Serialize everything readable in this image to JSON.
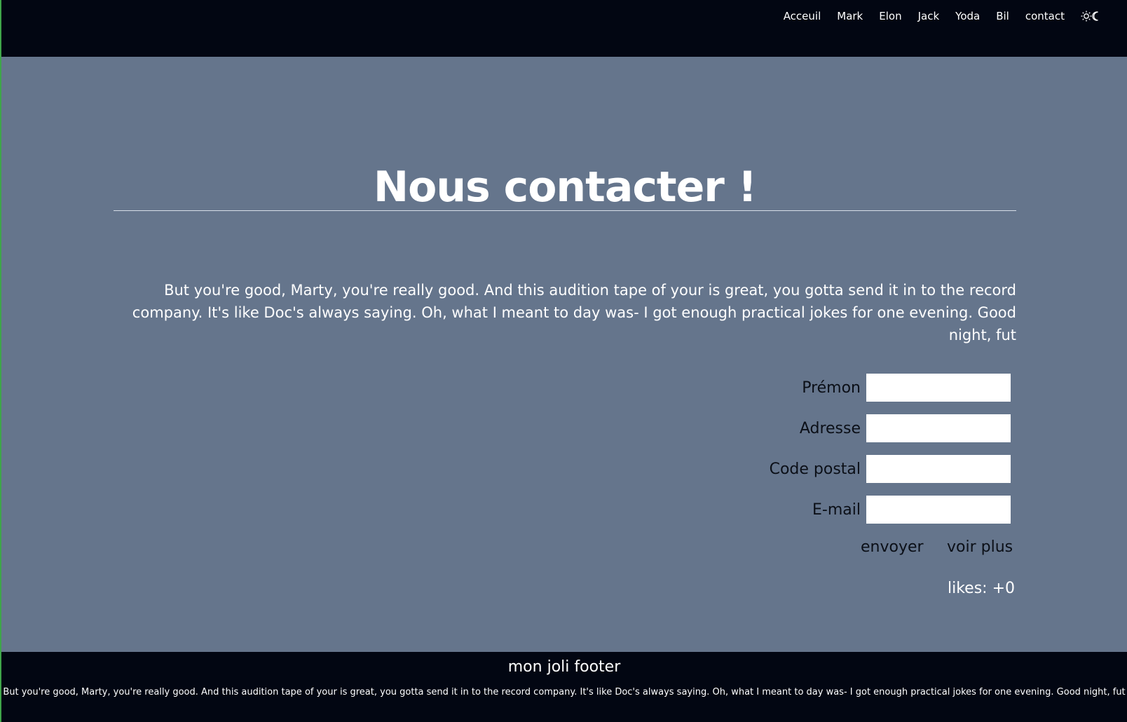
{
  "nav": {
    "items": [
      {
        "label": "Acceuil"
      },
      {
        "label": "Mark"
      },
      {
        "label": "Elon"
      },
      {
        "label": "Jack"
      },
      {
        "label": "Yoda"
      },
      {
        "label": "Bil"
      },
      {
        "label": "contact"
      }
    ],
    "theme_toggle_icon": "sun-moon-icon"
  },
  "main": {
    "title": "Nous contacter !",
    "intro": "But you're good, Marty, you're really good. And this audition tape of your is great, you gotta send it in to the record company. It's like Doc's always saying. Oh, what I meant to day was- I got enough practical jokes for one evening. Good night, fut"
  },
  "form": {
    "fields": [
      {
        "label": "Prémon",
        "value": "",
        "placeholder": ""
      },
      {
        "label": "Adresse",
        "value": "",
        "placeholder": ""
      },
      {
        "label": "Code postal",
        "value": "",
        "placeholder": ""
      },
      {
        "label": "E-mail",
        "value": "",
        "placeholder": ""
      }
    ],
    "submit_label": "envoyer",
    "more_label": "voir plus"
  },
  "likes": {
    "text": "likes: +0"
  },
  "footer": {
    "title": "mon joli footer",
    "text": "But you're good, Marty, you're really good. And this audition tape of your is great, you gotta send it in to the record company. It's like Doc's always saying. Oh, what I meant to day was- I got enough practical jokes for one evening. Good night, fut"
  },
  "colors": {
    "nav_bg": "#020612",
    "main_bg": "#65758c",
    "footer_bg": "#020612",
    "text_light": "#ffffff",
    "text_dark": "#0b0f17"
  }
}
